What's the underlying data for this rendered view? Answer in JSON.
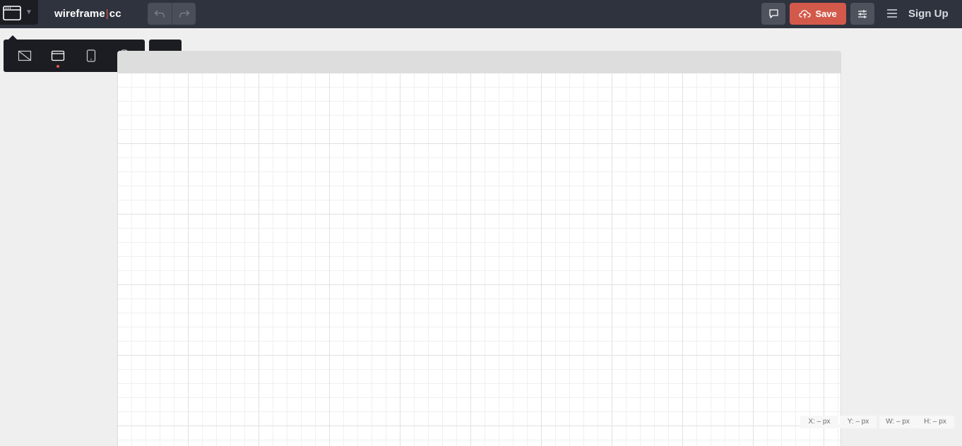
{
  "header": {
    "logo_left": "wireframe",
    "logo_sep": "|",
    "logo_right": "cc",
    "save_label": "Save",
    "signup_label": "Sign Up"
  },
  "coordinates": {
    "x": "X: – px",
    "y": "Y: – px",
    "w": "W: – px",
    "h": "H: – px"
  },
  "devices": {
    "active": "desktop",
    "items": [
      "no-frame",
      "desktop",
      "tablet",
      "phone"
    ]
  },
  "colors": {
    "topbar": "#2f333e",
    "accent": "#d35a4b",
    "toolbar": "#1b1d22"
  }
}
